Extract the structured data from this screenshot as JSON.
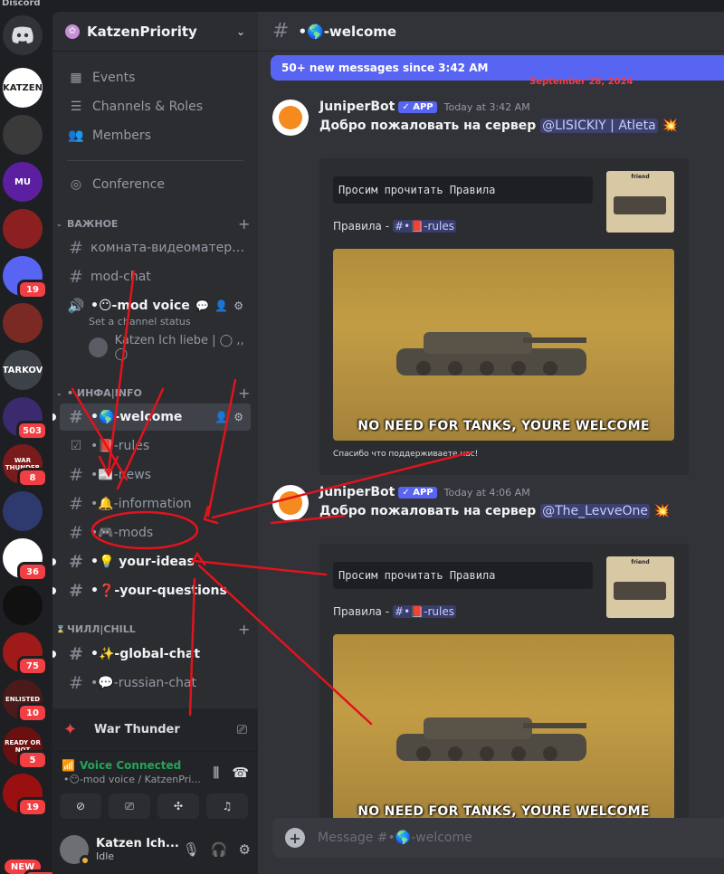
{
  "window": {
    "title": "Discord"
  },
  "rail": {
    "servers": [
      {
        "label": "KATZEN",
        "badge": "",
        "color": "#ffffff"
      },
      {
        "label": "",
        "badge": "",
        "color": "#3a3a3a"
      },
      {
        "label": "MU",
        "badge": "",
        "color": "#5b1fa0"
      },
      {
        "label": "",
        "badge": "",
        "color": "#8c2020"
      },
      {
        "label": "",
        "badge": "19",
        "color": "#5865f2"
      },
      {
        "label": "",
        "badge": "",
        "color": "#7a2a22"
      },
      {
        "label": "TARKOV",
        "badge": "",
        "color": "#3d4148"
      },
      {
        "label": "",
        "badge": "503",
        "color": "#3b2a6e"
      },
      {
        "label": "WAR THUNDER",
        "badge": "8",
        "color": "#7a1b1b"
      },
      {
        "label": "",
        "badge": "",
        "color": "#2e3a6d"
      },
      {
        "label": "",
        "badge": "36",
        "color": "#ffffff"
      },
      {
        "label": "",
        "badge": "",
        "color": "#111111"
      },
      {
        "label": "",
        "badge": "75",
        "color": "#a01a1a"
      },
      {
        "label": "ENLISTED",
        "badge": "10",
        "color": "#4b1a1a"
      },
      {
        "label": "READY OR NOT",
        "badge": "5",
        "color": "#6b1010"
      },
      {
        "label": "",
        "badge": "19",
        "color": "#9a1010"
      }
    ],
    "new_label": "NEW",
    "last_badge": "98"
  },
  "guild": {
    "name": "KatzenPriority"
  },
  "nav": {
    "events": "Events",
    "channels_roles": "Channels & Roles",
    "members": "Members",
    "conference": "Conference"
  },
  "categories": {
    "important": "ВАЖНОЕ",
    "info": "• ИНФА|INFO",
    "chill": "ЧИЛЛ|CHILL"
  },
  "channels": {
    "video": "комната-видеоматериа...",
    "modchat": "mod-chat",
    "modvoice": "•😶-mod voice",
    "modvoice_status": "Set a channel status",
    "voice_user": "Katzen Ich liebe | ◯ ,, ◯",
    "welcome": "•🌎-welcome",
    "rules": "•📕-rules",
    "news": "•📰-news",
    "information": "•🔔-information",
    "mods": "•🎮-mods",
    "ideas": "•💡 your-ideas",
    "questions": "•❓-your-questions",
    "global": "•✨-global-chat",
    "russian": "•💬-russian-chat"
  },
  "gamebar": {
    "title": "War Thunder"
  },
  "voice": {
    "status": "Voice Connected",
    "channel": "•😶-mod voice / KatzenPri..."
  },
  "user": {
    "name": "Katzen Ich...",
    "status": "Idle"
  },
  "main": {
    "channel": "•🌎-welcome",
    "newbar": "50+ new messages since 3:42 AM",
    "date": "September 28, 2024",
    "composer_placeholder": "Message #•🌎-welcome"
  },
  "messages": [
    {
      "author": "JuniperBot",
      "tag": "✓ APP",
      "time": "Today at 3:42 AM",
      "text": "Добро пожаловать на сервер ",
      "mention": "@LISICKIY | Atleta",
      "emoji": "💥",
      "code": "Просим прочитать Правила",
      "rules_label": "Правила -",
      "rules_link": "#•📕-rules",
      "thumb_title": "friend",
      "caption": "NO NEED FOR TANKS, YOURE WELCOME",
      "footer": "Спасибо что поддерживаете нас!"
    },
    {
      "author": "JuniperBot",
      "tag": "✓ APP",
      "time": "Today at 4:06 AM",
      "text": "Добро пожаловать на сервер ",
      "mention": "@The_LevveOne",
      "emoji": "💥",
      "code": "Просим прочитать Правила",
      "rules_label": "Правила -",
      "rules_link": "#•📕-rules",
      "thumb_title": "friend",
      "caption": "NO NEED FOR TANKS, YOURE WELCOME"
    }
  ],
  "colors": {
    "accent": "#5865f2",
    "annotation": "#e0141c",
    "online": "#23a559",
    "idle": "#f0b232"
  }
}
